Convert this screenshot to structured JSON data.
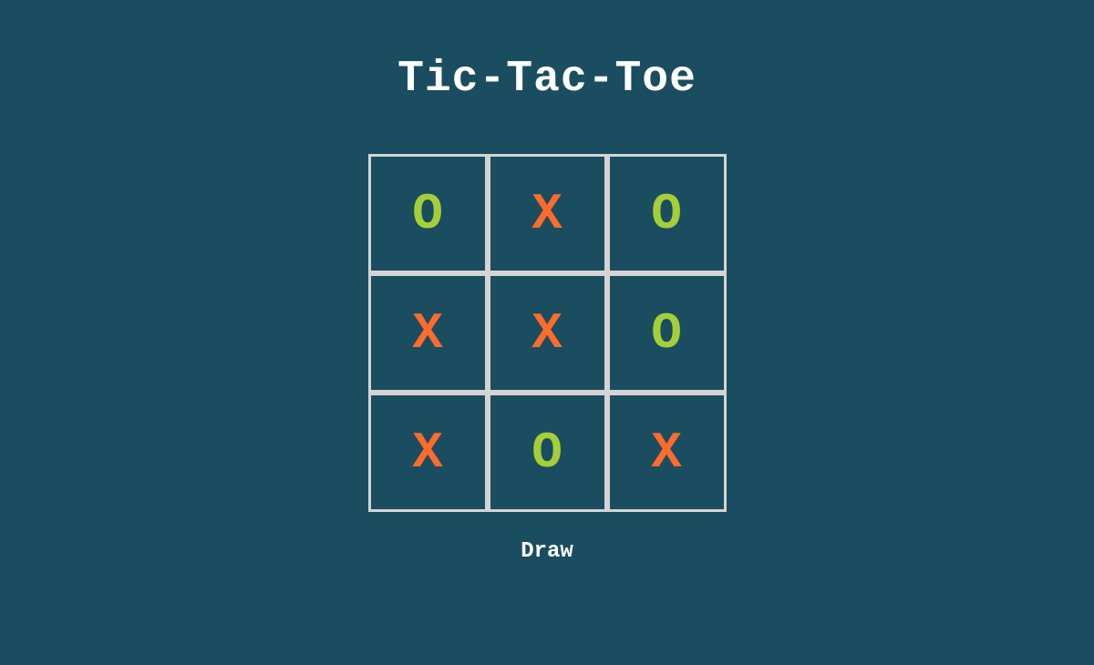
{
  "title": "Tic-Tac-Toe",
  "status": "Draw",
  "colors": {
    "background": "#1a4d5f",
    "grid": "#d4d4d4",
    "x": "#ff6b2b",
    "o": "#a6ce39",
    "text": "#ffffff"
  },
  "board": {
    "cells": [
      {
        "value": "O",
        "player": "o"
      },
      {
        "value": "X",
        "player": "x"
      },
      {
        "value": "O",
        "player": "o"
      },
      {
        "value": "X",
        "player": "x"
      },
      {
        "value": "X",
        "player": "x"
      },
      {
        "value": "O",
        "player": "o"
      },
      {
        "value": "X",
        "player": "x"
      },
      {
        "value": "O",
        "player": "o"
      },
      {
        "value": "X",
        "player": "x"
      }
    ]
  }
}
